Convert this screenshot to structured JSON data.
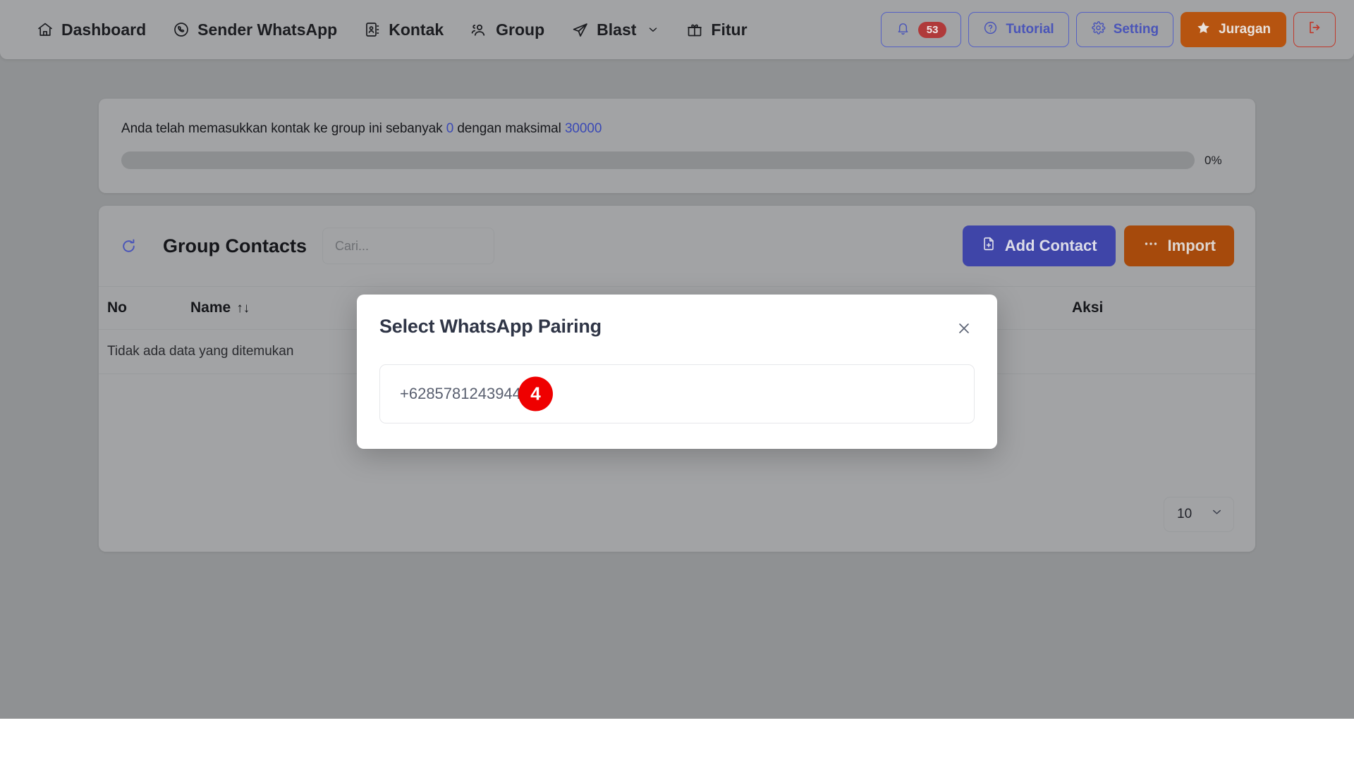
{
  "navbar": {
    "items": [
      {
        "label": "Dashboard",
        "icon": "home-icon",
        "has_caret": false
      },
      {
        "label": "Sender WhatsApp",
        "icon": "whatsapp-icon",
        "has_caret": false
      },
      {
        "label": "Kontak",
        "icon": "contact-book-icon",
        "has_caret": false
      },
      {
        "label": "Group",
        "icon": "users-icon",
        "has_caret": false
      },
      {
        "label": "Blast",
        "icon": "paper-plane-icon",
        "has_caret": true
      },
      {
        "label": "Fitur",
        "icon": "gift-icon",
        "has_caret": false
      }
    ],
    "notification": {
      "icon": "bell-icon",
      "count": "53"
    },
    "tutorial": {
      "label": "Tutorial",
      "icon": "question-circle-icon"
    },
    "setting": {
      "label": "Setting",
      "icon": "gear-icon"
    },
    "juragan": {
      "label": "Juragan",
      "icon": "star-icon"
    },
    "logout": {
      "icon": "logout-icon"
    },
    "colors": {
      "accent_blue": "#4a55b8",
      "accent_orange": "#b65410",
      "accent_red": "#c0392b",
      "badge_red": "#b03a3a"
    }
  },
  "quota": {
    "text_prefix": "Anda telah memasukkan kontak ke group ini sebanyak",
    "current": "0",
    "text_middle": "dengan maksimal",
    "maximum": "30000",
    "percent_label": "0%",
    "progress_value": 0
  },
  "contacts": {
    "refresh_icon": "refresh-icon",
    "title": "Group Contacts",
    "search_placeholder": "Cari...",
    "search_value": "",
    "add_contact": {
      "label": "Add Contact",
      "icon": "file-plus-icon"
    },
    "import": {
      "label": "Import",
      "icon": "ellipsis-icon"
    },
    "columns": [
      "No",
      "Name",
      "",
      "Aksi"
    ],
    "sort_indicator": "↑↓",
    "empty_message": "Tidak ada data yang ditemukan",
    "rows": [],
    "per_page": "10"
  },
  "modal": {
    "title": "Select WhatsApp Pairing",
    "close_icon": "close-icon",
    "options": [
      {
        "number": "+6285781243944"
      }
    ],
    "step_badge": "4",
    "step_badge_color": "#ef0000"
  }
}
